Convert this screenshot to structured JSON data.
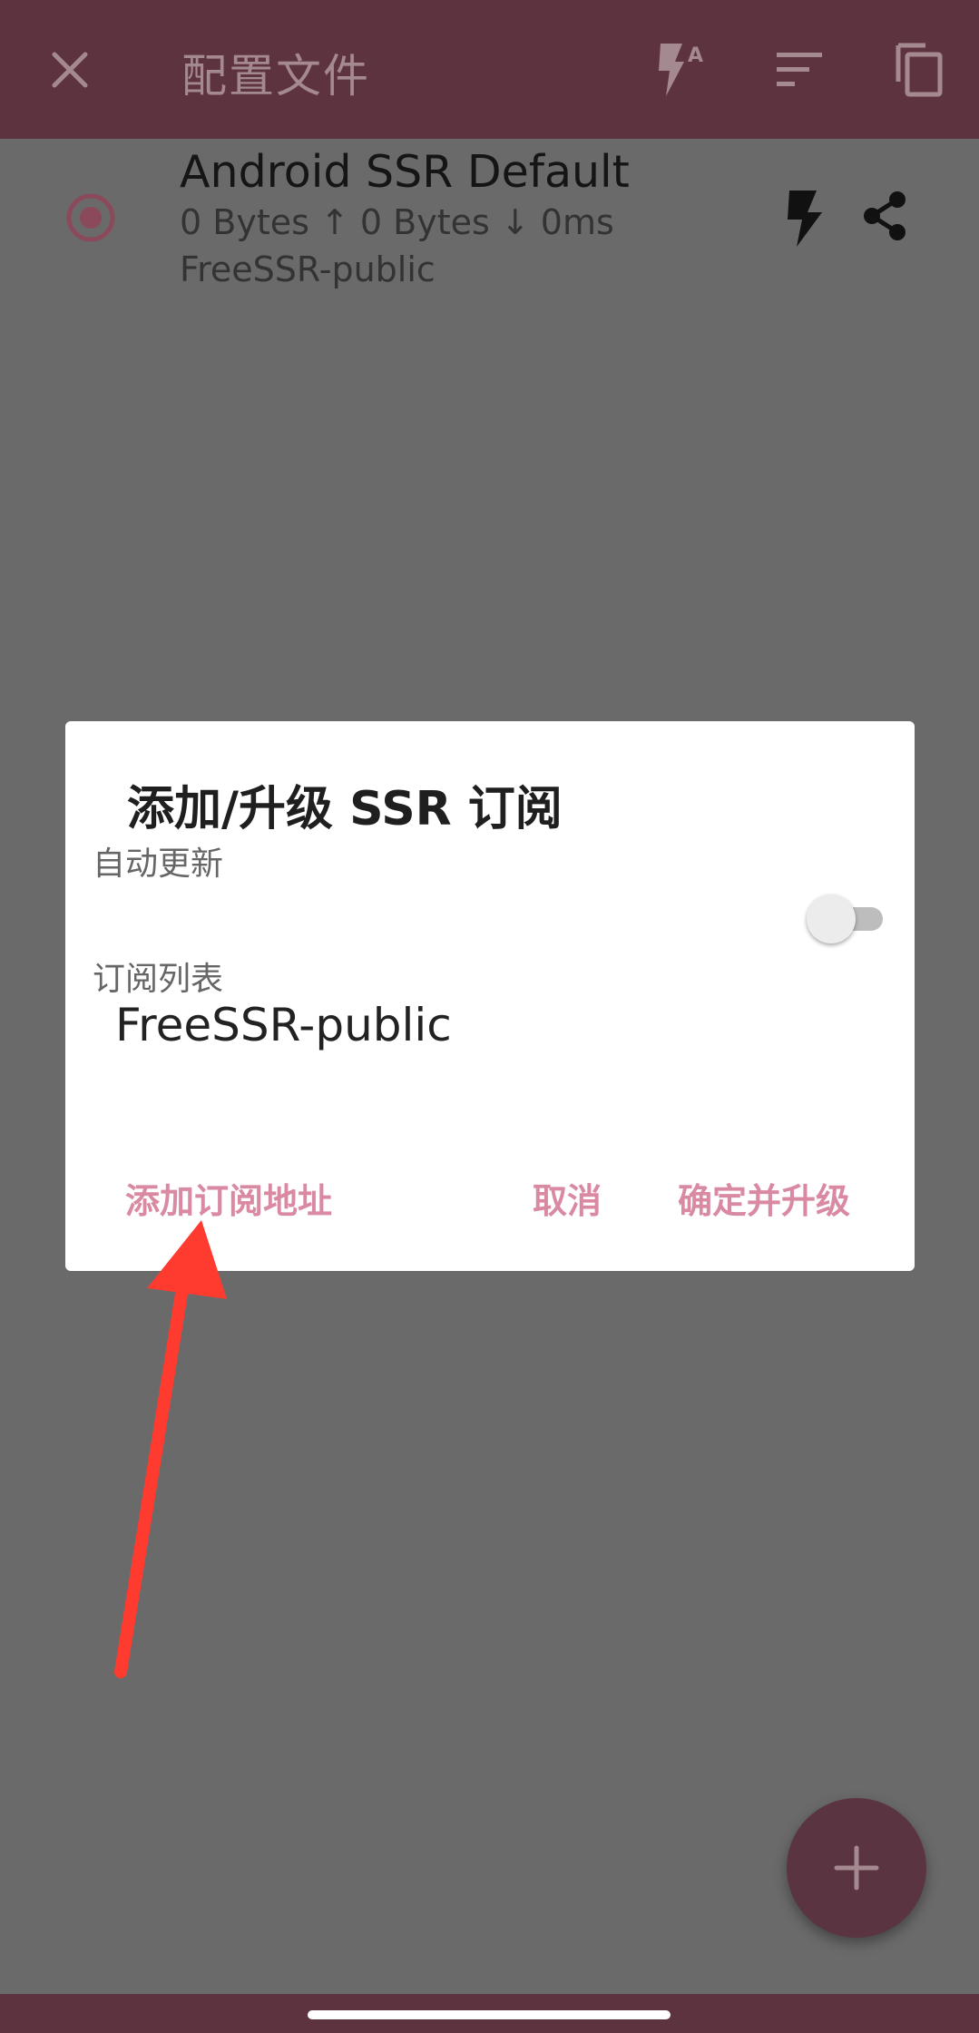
{
  "app_bar": {
    "title": "配置文件",
    "icons": [
      "close-icon",
      "flash-auto-icon",
      "sort-icon",
      "copy-icon"
    ],
    "background": "#5d3340"
  },
  "profile": {
    "name": "Android SSR Default",
    "stats": "0 Bytes ↑ 0 Bytes ↓ 0ms",
    "group": "FreeSSR-public",
    "selected": true,
    "icons": [
      "radio-selected-icon",
      "bolt-icon",
      "share-icon"
    ]
  },
  "dialog": {
    "title": "添加/升级 SSR 订阅",
    "auto_update_label": "自动更新",
    "auto_update_enabled": false,
    "list_label": "订阅列表",
    "list_items": [
      "FreeSSR-public"
    ],
    "buttons": {
      "add": "添加订阅地址",
      "cancel": "取消",
      "confirm": "确定并升级"
    },
    "accent": "#d98aa2"
  },
  "fab": {
    "icon": "plus-icon",
    "background": "#5b3441"
  },
  "annotation": {
    "arrow_color": "#ff3b30"
  }
}
